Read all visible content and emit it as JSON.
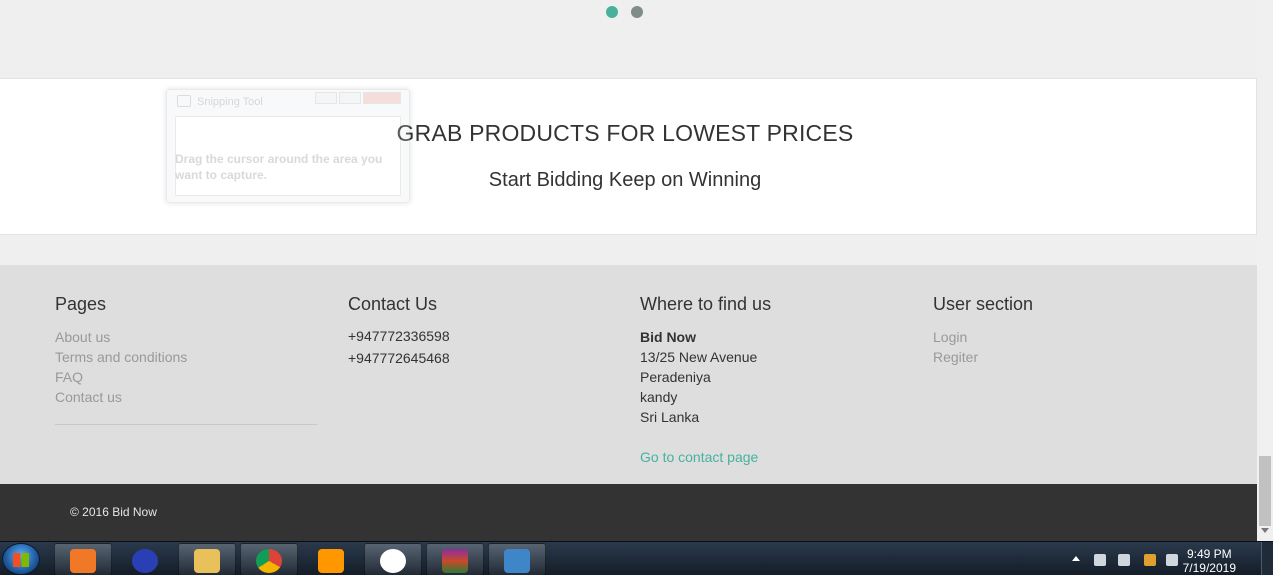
{
  "banner": {
    "title": "GRAB PRODUCTS FOR LOWEST PRICES",
    "subtitle": "Start Bidding Keep on Winning"
  },
  "snipping_tool": {
    "title": "Snipping Tool",
    "hint": "Drag the cursor around the area you want to capture."
  },
  "footer": {
    "pages": {
      "heading": "Pages",
      "links": [
        "About us",
        "Terms and conditions",
        "FAQ",
        "Contact us"
      ]
    },
    "contact": {
      "heading": "Contact Us",
      "phones": [
        "+947772336598",
        "+947772645468"
      ]
    },
    "where": {
      "heading": "Where to find us",
      "name": "Bid Now",
      "address": [
        "13/25 New Avenue",
        "Peradeniya",
        "kandy",
        "Sri Lanka"
      ],
      "contact_link": "Go to contact page"
    },
    "user": {
      "heading": "User section",
      "links": [
        "Login",
        "Regiter"
      ]
    }
  },
  "copyright": "© 2016 Bid Now",
  "taskbar": {
    "apps": [
      "xampp-icon",
      "eclipse-icon",
      "file-explorer-icon",
      "chrome-icon",
      "sublime-text-icon",
      "emoji-app-icon",
      "winrar-icon",
      "photo-viewer-icon"
    ],
    "time": "9:49 PM",
    "date": "7/19/2019"
  },
  "colors": {
    "accent": "#46b29d",
    "footer_bg": "#dedede",
    "copyright_bg": "#333333"
  }
}
